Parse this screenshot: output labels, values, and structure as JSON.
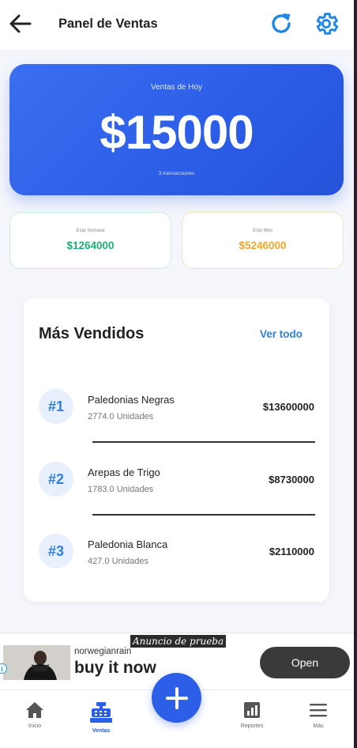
{
  "header": {
    "title": "Panel de Ventas"
  },
  "today": {
    "label": "Ventas de Hoy",
    "value": "$15000",
    "transactions": "3 transacciones"
  },
  "week": {
    "label": "Esta Semana",
    "value": "$1264000"
  },
  "month": {
    "label": "Este Mes",
    "value": "$5246000"
  },
  "top_sellers": {
    "title": "Más Vendidos",
    "see_all": "Ver todo",
    "items": [
      {
        "rank": "#1",
        "name": "Paledonias Negras",
        "units": "2774.0 Unidades",
        "amount": "$13600000"
      },
      {
        "rank": "#2",
        "name": "Arepas de Trigo",
        "units": "1783.0 Unidades",
        "amount": "$8730000"
      },
      {
        "rank": "#3",
        "name": "Paledonia Blanca",
        "units": "427.0 Unidades",
        "amount": "$2110000"
      }
    ]
  },
  "ad": {
    "tag": "Anuncio de prueba",
    "brand": "norwegianrain",
    "headline": "buy it now",
    "cta": "Open",
    "info": "i"
  },
  "nav": {
    "items": [
      {
        "label": "Inicio",
        "icon": "home-icon"
      },
      {
        "label": "Ventas",
        "icon": "cash-register-icon"
      },
      {
        "label": "Reportes",
        "icon": "chart-icon"
      },
      {
        "label": "Más",
        "icon": "menu-icon"
      }
    ]
  },
  "colors": {
    "primary": "#2d5ee8",
    "link": "#2f7fe0",
    "week": "#1fae7a",
    "month": "#f2a72e"
  }
}
